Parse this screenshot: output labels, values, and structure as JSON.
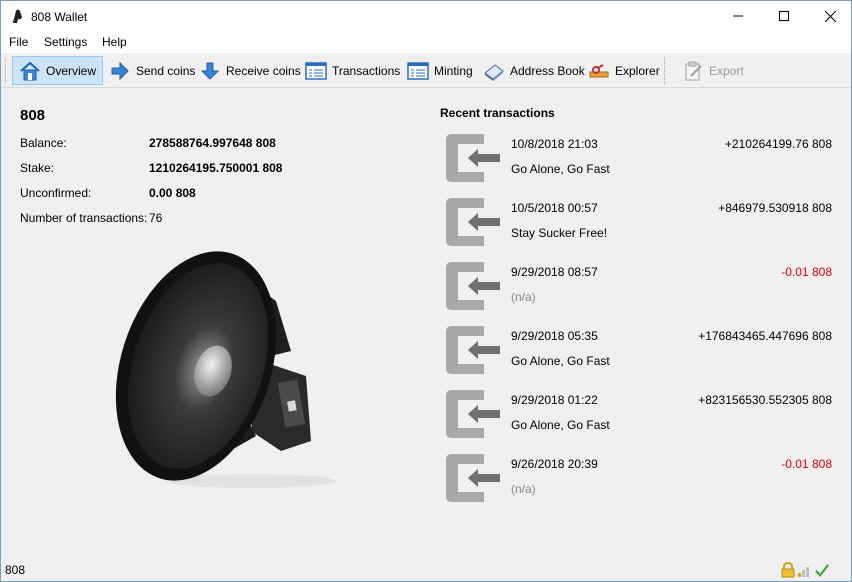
{
  "window": {
    "title": "808 Wallet"
  },
  "menu": {
    "file": "File",
    "settings": "Settings",
    "help": "Help"
  },
  "toolbar": {
    "overview": "Overview",
    "send": "Send coins",
    "receive": "Receive coins",
    "transactions": "Transactions",
    "minting": "Minting",
    "address_book": "Address Book",
    "explorer": "Explorer",
    "export": "Export"
  },
  "overview": {
    "wallet_name": "808",
    "balance_label": "Balance:",
    "balance_value": "278588764.997648 808",
    "stake_label": "Stake:",
    "stake_value": "1210264195.750001 808",
    "unconfirmed_label": "Unconfirmed:",
    "unconfirmed_value": "0.00 808",
    "ntx_label": "Number of transactions:",
    "ntx_value": "76"
  },
  "recent": {
    "title": "Recent transactions",
    "items": [
      {
        "date": "10/8/2018 21:03",
        "amount": "+210264199.76 808",
        "label": "Go Alone, Go Fast",
        "negative": false
      },
      {
        "date": "10/5/2018 00:57",
        "amount": "+846979.530918 808",
        "label": "Stay Sucker Free!",
        "negative": false
      },
      {
        "date": "9/29/2018 08:57",
        "amount": "-0.01 808",
        "label": "(n/a)",
        "negative": true
      },
      {
        "date": "9/29/2018 05:35",
        "amount": "+176843465.447696 808",
        "label": "Go Alone, Go Fast",
        "negative": false
      },
      {
        "date": "9/29/2018 01:22",
        "amount": "+823156530.552305 808",
        "label": "Go Alone, Go Fast",
        "negative": false
      },
      {
        "date": "9/26/2018 20:39",
        "amount": "-0.01 808",
        "label": "(n/a)",
        "negative": true
      }
    ]
  },
  "statusbar": {
    "text": "808"
  },
  "colors": {
    "negative": "#e00000",
    "active_tab": "#cce4f7"
  }
}
